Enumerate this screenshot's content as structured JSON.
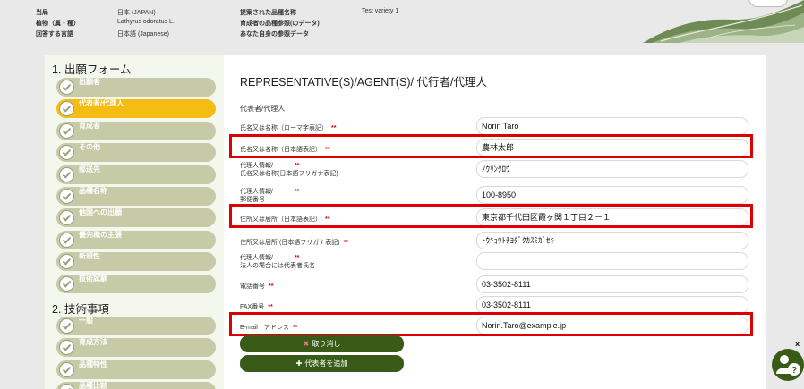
{
  "header": {
    "rows": [
      {
        "label": "当局",
        "value": "日本 (JAPAN)"
      },
      {
        "label": "植物（属・種）",
        "value": "Lathyrus odoratus L."
      },
      {
        "label": "回答する言語",
        "value": "日本語 (Japanese)"
      }
    ],
    "rows2": [
      {
        "label": "提案された品種名称",
        "value": "Test variety 1"
      },
      {
        "label": "育成者の品種参照(のデータ)",
        "value": ""
      },
      {
        "label": "あなた自身の参照データ",
        "value": ""
      }
    ]
  },
  "sidebar": {
    "section1": "1. 出願フォーム",
    "items1": [
      {
        "label": "出願者",
        "active": false
      },
      {
        "label": "代表者/代理人",
        "active": true
      },
      {
        "label": "育成者",
        "active": false
      },
      {
        "label": "その他",
        "active": false
      },
      {
        "label": "郵送先",
        "active": false
      },
      {
        "label": "品種名称",
        "active": false
      },
      {
        "label": "他国への出願",
        "active": false
      },
      {
        "label": "優先権の主張",
        "active": false
      },
      {
        "label": "新規性",
        "active": false
      },
      {
        "label": "技術試験",
        "active": false
      }
    ],
    "section2": "2. 技術事項",
    "items2": [
      {
        "label": "一般",
        "active": false
      },
      {
        "label": "育成方法",
        "active": false
      },
      {
        "label": "品種特性",
        "active": false
      },
      {
        "label": "品種比較",
        "active": false
      }
    ]
  },
  "main": {
    "title": "REPRESENTATIVE(S)/AGENT(S)/ 代行者/代理人",
    "subtitle": "代表者/代理人",
    "fields": [
      {
        "l1": "氏名又は名称（ローマ字表記）",
        "l2": "",
        "req": "**",
        "value": "Norin Taro",
        "highlight": false
      },
      {
        "l1": "氏名又は名称（日本語表記）",
        "l2": "",
        "req": "**",
        "value": "農林太郎",
        "highlight": true
      },
      {
        "l1": "代理人情報/",
        "l2": "氏名又は名称(日本語フリガナ表記)",
        "req": "**",
        "value": "ﾉｳﾘﾝﾀﾛｳ",
        "highlight": false
      },
      {
        "l1": "代理人情報/",
        "l2": "郵便番号",
        "req": "**",
        "value": "100-8950",
        "highlight": false
      },
      {
        "l1": "住所又は居所（日本語表記）",
        "l2": "",
        "req": "**",
        "value": "東京都千代田区霞ヶ関１丁目２－１",
        "highlight": true
      },
      {
        "l1": "住所又は居所 (日本語フリガナ表記)",
        "l2": "",
        "req": "**",
        "value": "ﾄｳｷｮｳﾄﾁﾖﾀﾞｸｶｽﾐｶﾞｾｷ",
        "highlight": false
      },
      {
        "l1": "代理人情報/",
        "l2": "法人の場合には代表者氏名",
        "req": "**",
        "value": "",
        "highlight": false
      },
      {
        "l1": "電話番号",
        "l2": "",
        "req": "**",
        "value": "03-3502-8111",
        "highlight": false
      },
      {
        "l1": "FAX番号",
        "l2": "",
        "req": "**",
        "value": "03-3502-8111",
        "highlight": false
      },
      {
        "l1": "E-mail　アドレス",
        "l2": "",
        "req": "**",
        "value": "Norin.Taro@example.jp",
        "highlight": true
      }
    ],
    "buttons": {
      "cancel_icon": "✖",
      "cancel": "取り消し",
      "add_icon": "✚",
      "add": "代表者を追加"
    }
  },
  "colors": {
    "active": "#f5bd14",
    "inactive": "#c6caa6",
    "button": "#3a5b17",
    "highlight": "#dd0000"
  },
  "icons": [
    "check-icon",
    "leaf-decoration",
    "close-icon",
    "help-user-icon"
  ],
  "close_label": "×"
}
